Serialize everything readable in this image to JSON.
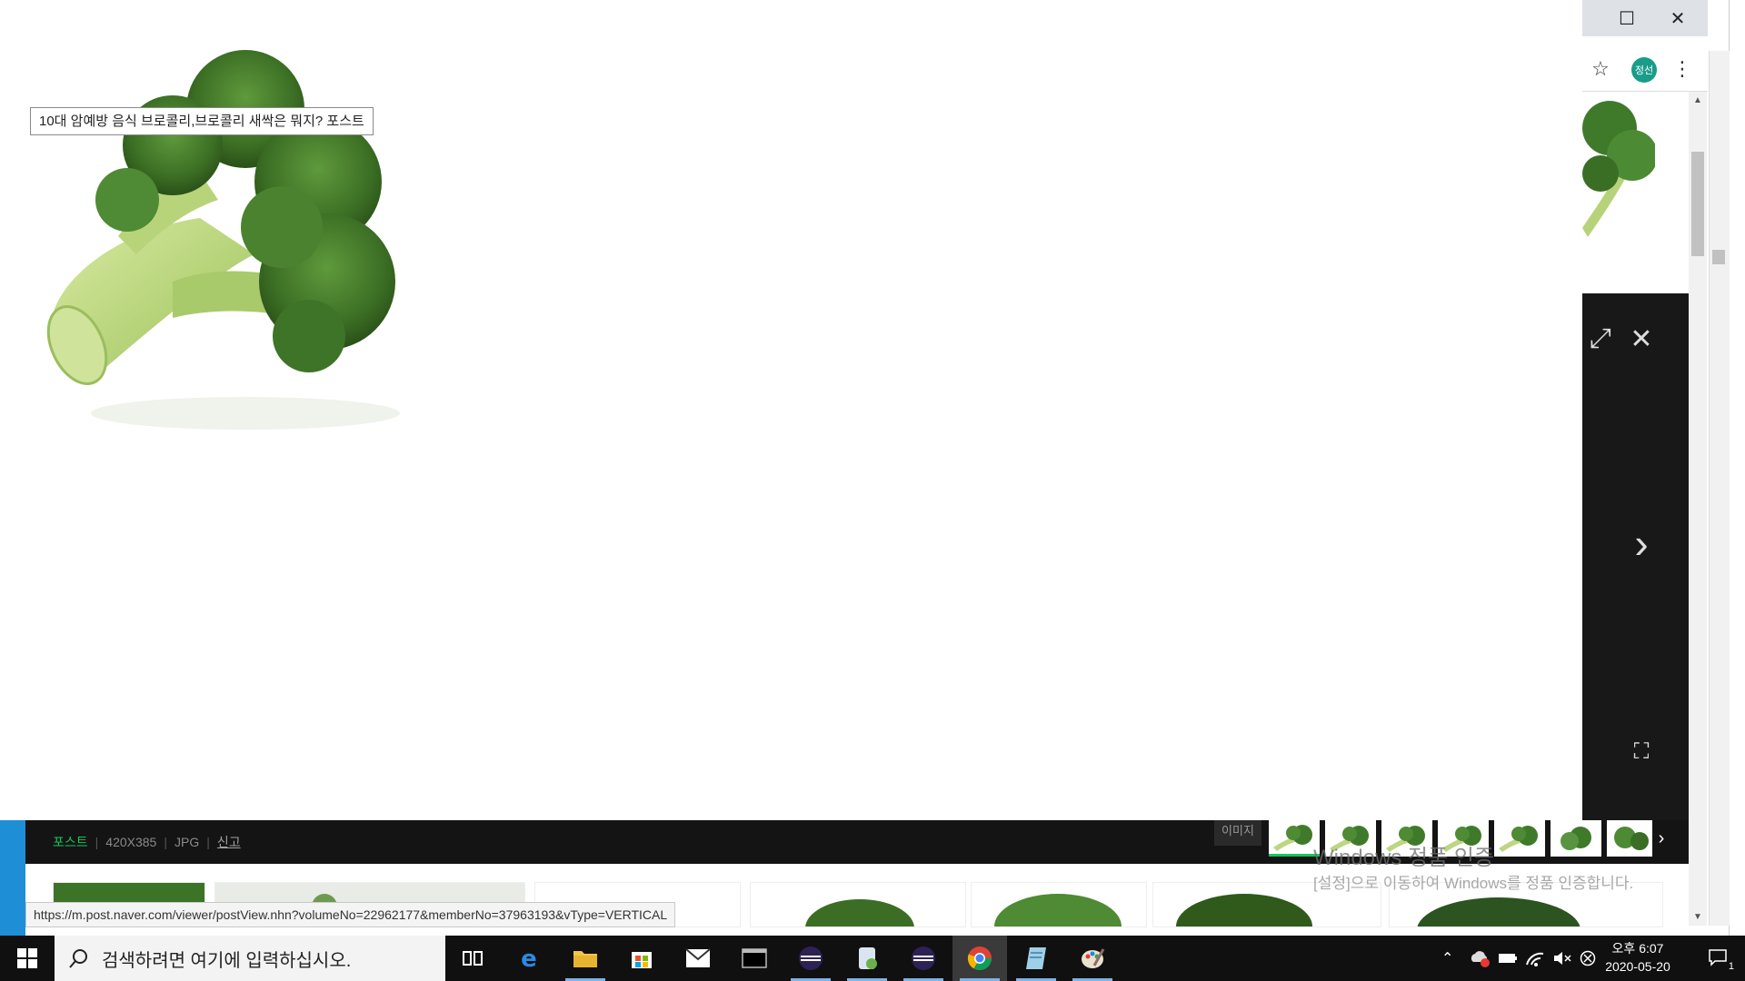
{
  "popup": {
    "tooltip": "10대 암예방 음식 브로콜리,브로콜리 새싹은 뭐지? 포스트"
  },
  "browser": {
    "window_controls": {
      "maximize": "☐",
      "close": "✕"
    },
    "profile_initials": "정선",
    "bookmark_star": "☆",
    "menu": "⋮"
  },
  "viewer": {
    "expand_icon": "⤢",
    "close_icon": "✕",
    "next_icon": "›",
    "fullscreen_icon": "⛶"
  },
  "infobar": {
    "source": "포스트",
    "dimensions": "420X385",
    "format": "JPG",
    "report": "신고",
    "image_label": "이미지",
    "thumb_next": "›"
  },
  "watermark": {
    "title": "Windows 정품 인증",
    "subtitle": "[설정]으로 이동하여 Windows를 정품 인증합니다."
  },
  "status_url": "https://m.post.naver.com/viewer/postView.nhn?volumeNo=22962177&memberNo=37963193&vType=VERTICAL",
  "taskbar": {
    "search_placeholder": "검색하려면 여기에 입력하십시오.",
    "clock_time": "오후 6:07",
    "clock_date": "2020-05-20",
    "notification_count": "1",
    "apps": [
      "task-view",
      "edge",
      "file-explorer",
      "store",
      "mail",
      "terminal",
      "eclipse",
      "notepad-plus",
      "eclipse-2",
      "chrome",
      "notepad",
      "paint"
    ]
  },
  "colors": {
    "accent_green": "#13c75d",
    "viewer_bg": "#181818",
    "taskbar_bg": "#101010",
    "profile_teal": "#1a9c8a"
  }
}
